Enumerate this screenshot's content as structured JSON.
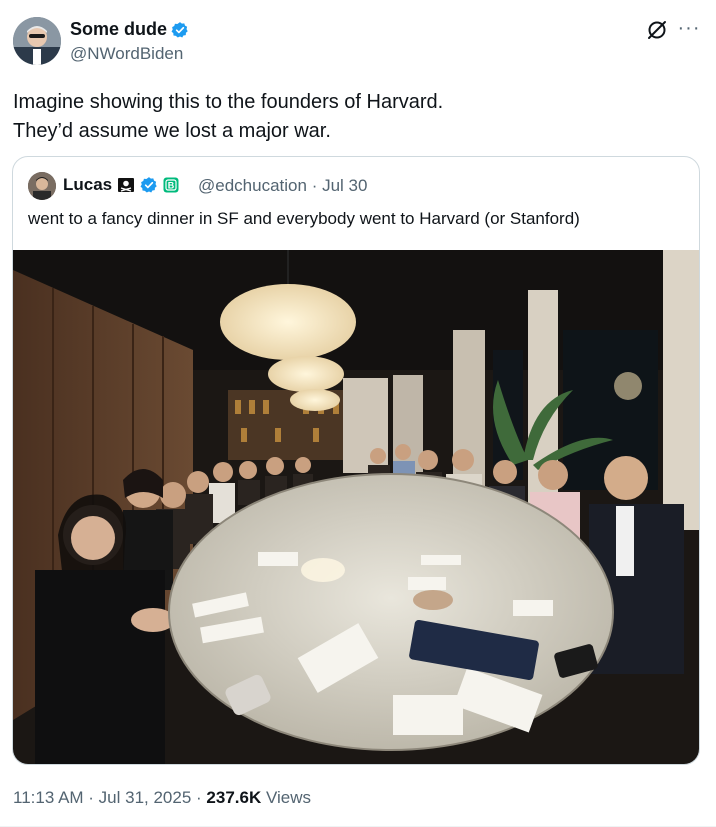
{
  "tweet": {
    "author_name": "Some dude",
    "handle": "@NWordBiden",
    "text_line1": "Imagine showing this to the founders of Harvard.",
    "text_line2": "They’d assume we lost a major war.",
    "timestamp": "11:13 AM · Jul 31, 2025 ·",
    "views_count": "237.6K",
    "views_label": "Views"
  },
  "quote": {
    "author_name": "Lucas",
    "handle": "@edchucation",
    "date": "· Jul 30",
    "text": "went to a fancy dinner in SF and everybody went to Harvard (or Stanford)",
    "photo_description_icon": "restaurant-group-photo"
  },
  "colors": {
    "verified_blue": "#1d9bf0",
    "secondary_text": "#536471",
    "border": "#cfd9de",
    "badge_green": "#00ba7c"
  },
  "icons": [
    "verified-badge-icon",
    "grok-icon",
    "more-icon",
    "pirate-flag-icon",
    "b-badge-icon"
  ]
}
